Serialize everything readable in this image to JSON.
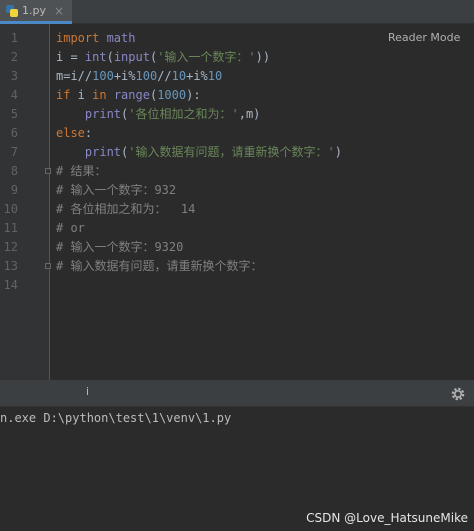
{
  "tab": {
    "label": "1.py",
    "close": "×"
  },
  "reader_mode": "Reader Mode",
  "line_numbers": [
    "1",
    "2",
    "3",
    "4",
    "5",
    "6",
    "7",
    "8",
    "9",
    "10",
    "11",
    "12",
    "13",
    "14"
  ],
  "code": [
    [
      {
        "t": "import",
        "c": "kw"
      },
      {
        "t": " math",
        "c": "bi"
      }
    ],
    [
      {
        "t": "i = ",
        "c": ""
      },
      {
        "t": "int",
        "c": "bi"
      },
      {
        "t": "(",
        "c": ""
      },
      {
        "t": "input",
        "c": "bi"
      },
      {
        "t": "(",
        "c": ""
      },
      {
        "t": "'输入一个数字：'",
        "c": "str"
      },
      {
        "t": "))",
        "c": ""
      }
    ],
    [
      {
        "t": "m=i//",
        "c": ""
      },
      {
        "t": "100",
        "c": "num"
      },
      {
        "t": "+i%",
        "c": ""
      },
      {
        "t": "100",
        "c": "num"
      },
      {
        "t": "//",
        "c": ""
      },
      {
        "t": "10",
        "c": "num"
      },
      {
        "t": "+i%",
        "c": ""
      },
      {
        "t": "10",
        "c": "num"
      }
    ],
    [
      {
        "t": "if",
        "c": "kw"
      },
      {
        "t": " i ",
        "c": ""
      },
      {
        "t": "in",
        "c": "kw"
      },
      {
        "t": " ",
        "c": ""
      },
      {
        "t": "range",
        "c": "bi"
      },
      {
        "t": "(",
        "c": ""
      },
      {
        "t": "1000",
        "c": "num"
      },
      {
        "t": "):",
        "c": ""
      }
    ],
    [
      {
        "t": "    ",
        "c": ""
      },
      {
        "t": "print",
        "c": "bi"
      },
      {
        "t": "(",
        "c": ""
      },
      {
        "t": "'各位相加之和为：'",
        "c": "str"
      },
      {
        "t": ",m)",
        "c": ""
      }
    ],
    [
      {
        "t": "else",
        "c": "kw"
      },
      {
        "t": ":",
        "c": ""
      }
    ],
    [
      {
        "t": "    ",
        "c": ""
      },
      {
        "t": "print",
        "c": "bi"
      },
      {
        "t": "(",
        "c": ""
      },
      {
        "t": "'输入数据有问题，请重新换个数字：'",
        "c": "str"
      },
      {
        "t": ")",
        "c": ""
      }
    ],
    [
      {
        "t": "# 结果：",
        "c": "cm"
      }
    ],
    [
      {
        "t": "# 输入一个数字：932",
        "c": "cm"
      }
    ],
    [
      {
        "t": "# 各位相加之和为：  14",
        "c": "cm"
      }
    ],
    [
      {
        "t": "# or",
        "c": "cm"
      }
    ],
    [
      {
        "t": "# 输入一个数字：9320",
        "c": "cm"
      }
    ],
    [
      {
        "t": "# 输入数据有问题，请重新换个数字：",
        "c": "cm"
      }
    ],
    []
  ],
  "run_panel": {
    "cursor_mark": "i"
  },
  "console": {
    "output": "n.exe D:\\python\\test\\1\\venv\\1.py"
  },
  "watermark": "CSDN @Love_HatsuneMike",
  "colors": {
    "keyword": "#cc7832",
    "builtin": "#8888c6",
    "string": "#6a8759",
    "number": "#6897bb",
    "comment": "#808080",
    "background": "#2b2b2b"
  },
  "icons": {
    "file": "python-file-icon",
    "settings": "gear-icon"
  }
}
